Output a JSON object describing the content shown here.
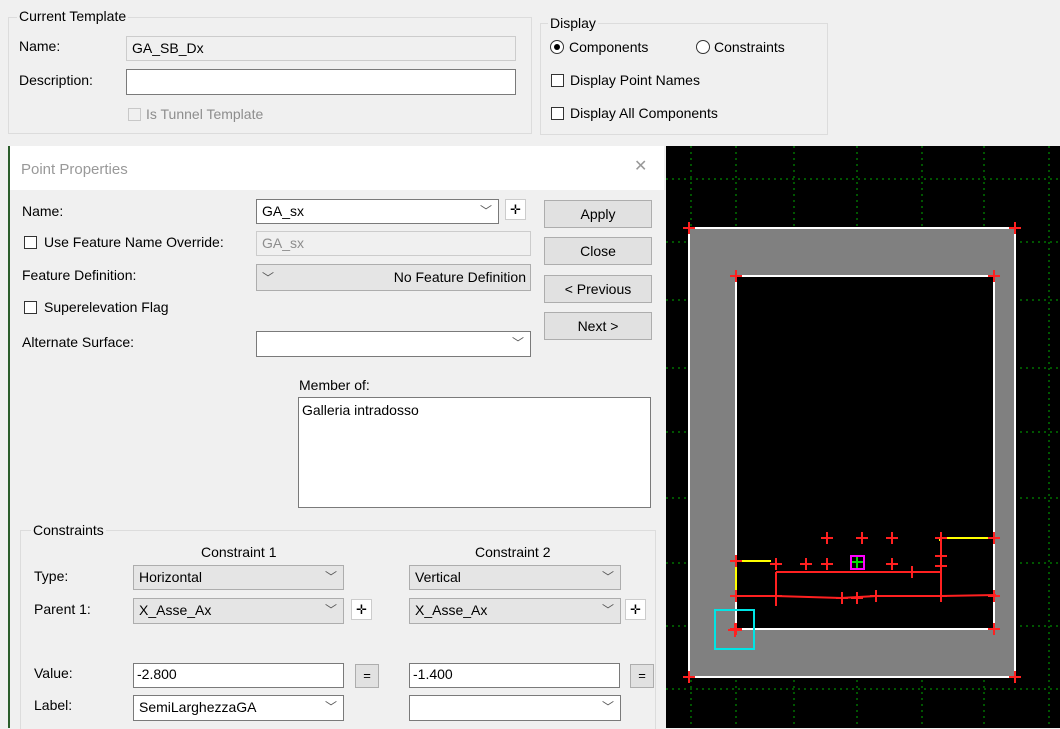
{
  "template": {
    "group_title": "Current Template",
    "name_label": "Name:",
    "name_value": "GA_SB_Dx",
    "description_label": "Description:",
    "description_value": "",
    "tunnel_label": "Is Tunnel Template"
  },
  "display": {
    "group_title": "Display",
    "radio_components": "Components",
    "radio_constraints": "Constraints",
    "selected": "Components",
    "point_names_label": "Display Point Names",
    "all_components_label": "Display All Components"
  },
  "dialog": {
    "title": "Point Properties",
    "close_glyph": "✕",
    "name_label": "Name:",
    "name_value": "GA_sx",
    "override_label": "Use Feature Name Override:",
    "override_value": "GA_sx",
    "feature_label": "Feature Definition:",
    "feature_value": "No Feature Definition",
    "superelevation_label": "Superelevation Flag",
    "alt_surface_label": "Alternate Surface:",
    "alt_surface_value": "",
    "member_label": "Member of:",
    "member_items": [
      "Galleria intradosso"
    ],
    "buttons": {
      "apply": "Apply",
      "close": "Close",
      "previous": "< Previous",
      "next": "Next >"
    }
  },
  "constraints": {
    "group_title": "Constraints",
    "col1_title": "Constraint 1",
    "col2_title": "Constraint 2",
    "type_label": "Type:",
    "parent_label": "Parent 1:",
    "value_label": "Value:",
    "label_label": "Label:",
    "c1": {
      "type": "Horizontal",
      "parent": "X_Asse_Ax",
      "value": "-2.800",
      "label": "SemiLarghezzaGA"
    },
    "c2": {
      "type": "Vertical",
      "parent": "X_Asse_Ax",
      "value": "-1.400",
      "label": ""
    },
    "equals_glyph": "="
  },
  "icons": {
    "chevron": "chevron-down-icon",
    "pick_point": "pick-point-icon",
    "close": "close-icon"
  },
  "colors": {
    "viewport_bg": "#000000",
    "section_fill": "#808080",
    "grid": "#00aa00",
    "point": "#ff0000",
    "selected_point": "#ff00ff",
    "selection_box": "#00e5e5",
    "highlight": "#ffff00"
  }
}
